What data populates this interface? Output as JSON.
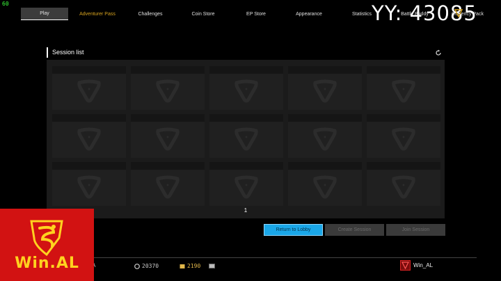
{
  "overlay": {
    "fps": "60",
    "yy_text": "YY:  43085"
  },
  "nav": {
    "tabs": [
      {
        "label": "Play",
        "active": true
      },
      {
        "label": "Adventurer Pass",
        "highlight": true
      },
      {
        "label": "Challenges"
      },
      {
        "label": "Coin Store"
      },
      {
        "label": "EP Store"
      },
      {
        "label": "Appearance"
      },
      {
        "label": "Statistics"
      },
      {
        "label": "Battle Buddy"
      },
      {
        "label": "Currency Pack"
      }
    ]
  },
  "session": {
    "title": "Session list",
    "page": "1",
    "cards": 15
  },
  "buttons": {
    "return": "Return to Lobby",
    "create": "Create Session",
    "join": "Join Session"
  },
  "bottom": {
    "partial_label": "A",
    "coins": "20370",
    "ep": "2190",
    "player_name": "Win_AL"
  },
  "logo": {
    "text": "Win.AL"
  },
  "colors": {
    "accent_blue": "#1aa7e8",
    "gold": "#d7a31f",
    "logo_red": "#d21212",
    "logo_yellow": "#ffd21f"
  }
}
